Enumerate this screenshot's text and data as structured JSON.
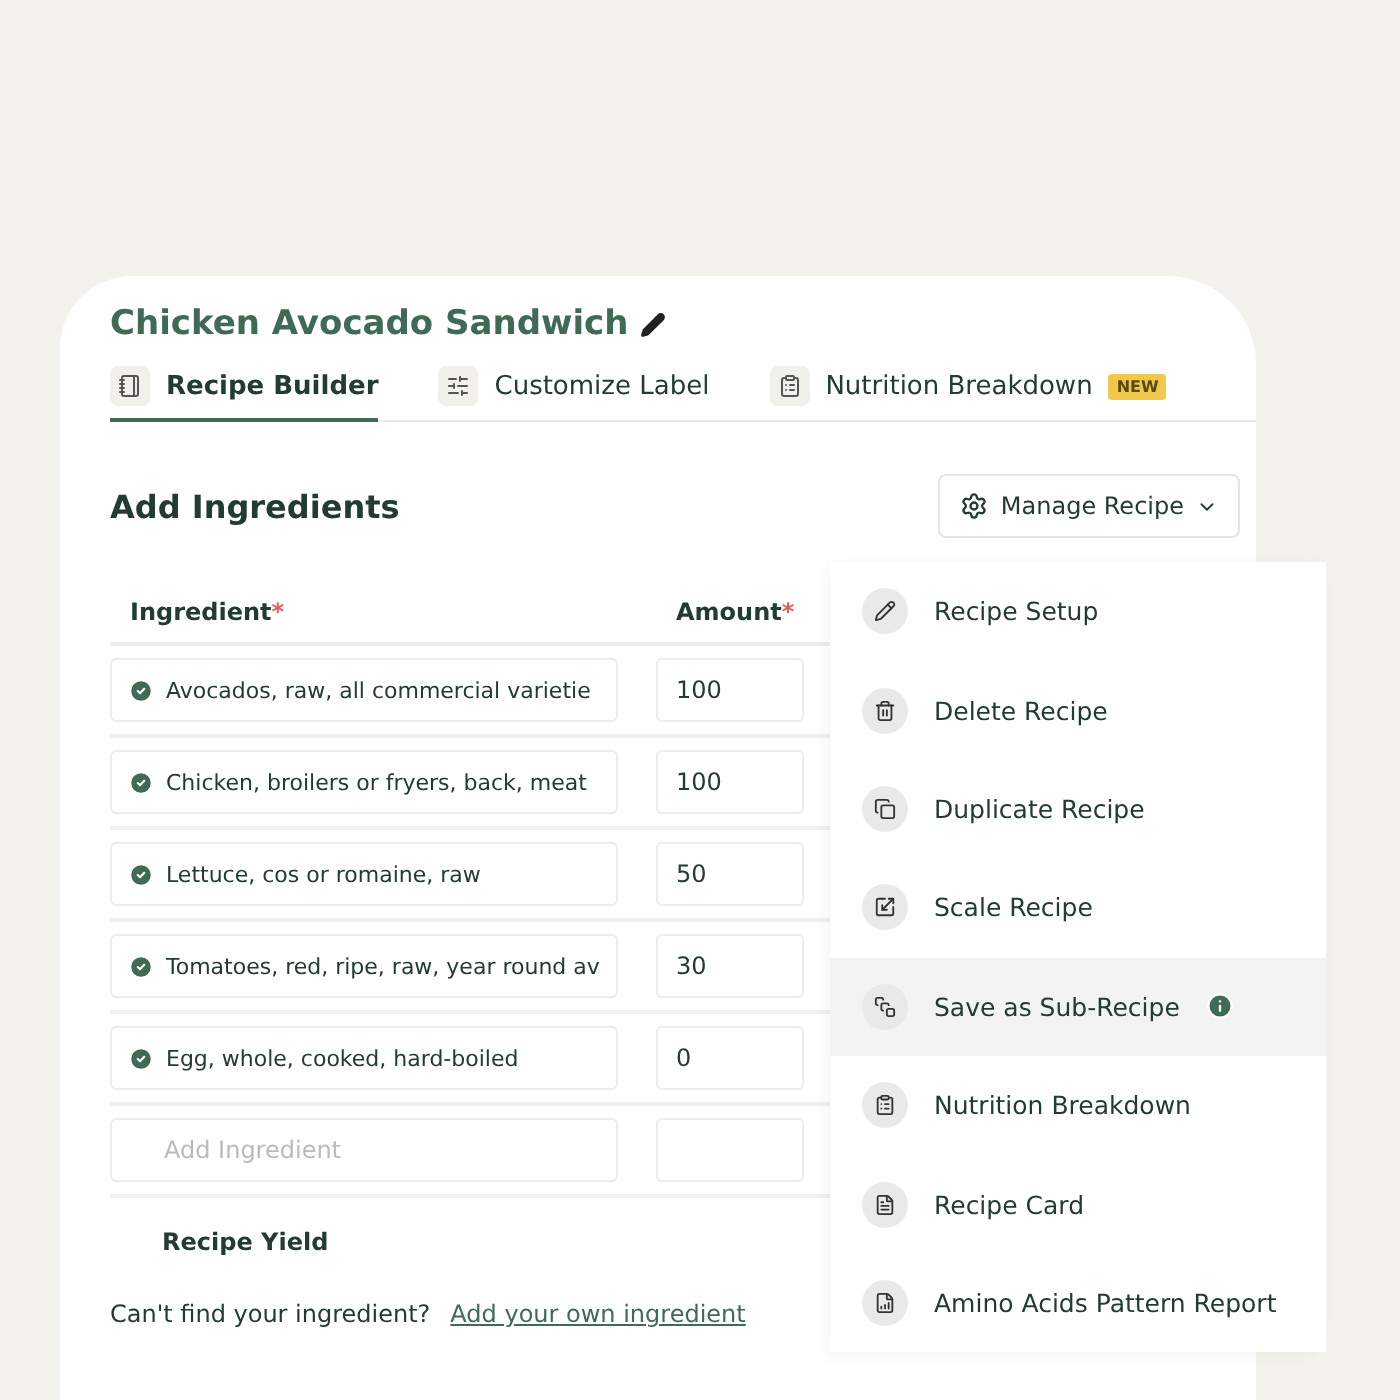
{
  "recipe": {
    "title": "Chicken Avocado Sandwich"
  },
  "tabs": [
    {
      "label": "Recipe Builder",
      "selected": true
    },
    {
      "label": "Customize Label",
      "selected": false
    },
    {
      "label": "Nutrition Breakdown",
      "selected": false,
      "badge": "NEW"
    }
  ],
  "section": {
    "title": "Add Ingredients",
    "manage_button": "Manage Recipe"
  },
  "table": {
    "columns": [
      {
        "label": "Ingredient",
        "required_mark": "*"
      },
      {
        "label": "Amount",
        "required_mark": "*"
      }
    ],
    "rows": [
      {
        "ingredient": "Avocados, raw, all commercial varietie",
        "amount": "100",
        "matched": true
      },
      {
        "ingredient": "Chicken, broilers or fryers, back, meat",
        "amount": "100",
        "matched": true
      },
      {
        "ingredient": "Lettuce, cos or romaine, raw",
        "amount": "50",
        "matched": true
      },
      {
        "ingredient": "Tomatoes, red, ripe, raw, year round av",
        "amount": "30",
        "matched": true
      },
      {
        "ingredient": "Egg, whole, cooked, hard-boiled",
        "amount": "0",
        "matched": true
      }
    ],
    "new_row": {
      "placeholder": "Add Ingredient"
    },
    "yield_label": "Recipe Yield"
  },
  "footer": {
    "question": "Can't find your ingredient?",
    "link": "Add your own ingredient"
  },
  "menu": {
    "items": [
      {
        "label": "Recipe Setup",
        "highlighted": false,
        "info": false
      },
      {
        "label": "Delete Recipe",
        "highlighted": false,
        "info": false
      },
      {
        "label": "Duplicate Recipe",
        "highlighted": false,
        "info": false
      },
      {
        "label": "Scale Recipe",
        "highlighted": false,
        "info": false
      },
      {
        "label": "Save as Sub-Recipe",
        "highlighted": true,
        "info": true
      },
      {
        "label": "Nutrition Breakdown",
        "highlighted": false,
        "info": false
      },
      {
        "label": "Recipe Card",
        "highlighted": false,
        "info": false
      },
      {
        "label": "Amino Acids Pattern Report",
        "highlighted": false,
        "info": false
      }
    ]
  }
}
